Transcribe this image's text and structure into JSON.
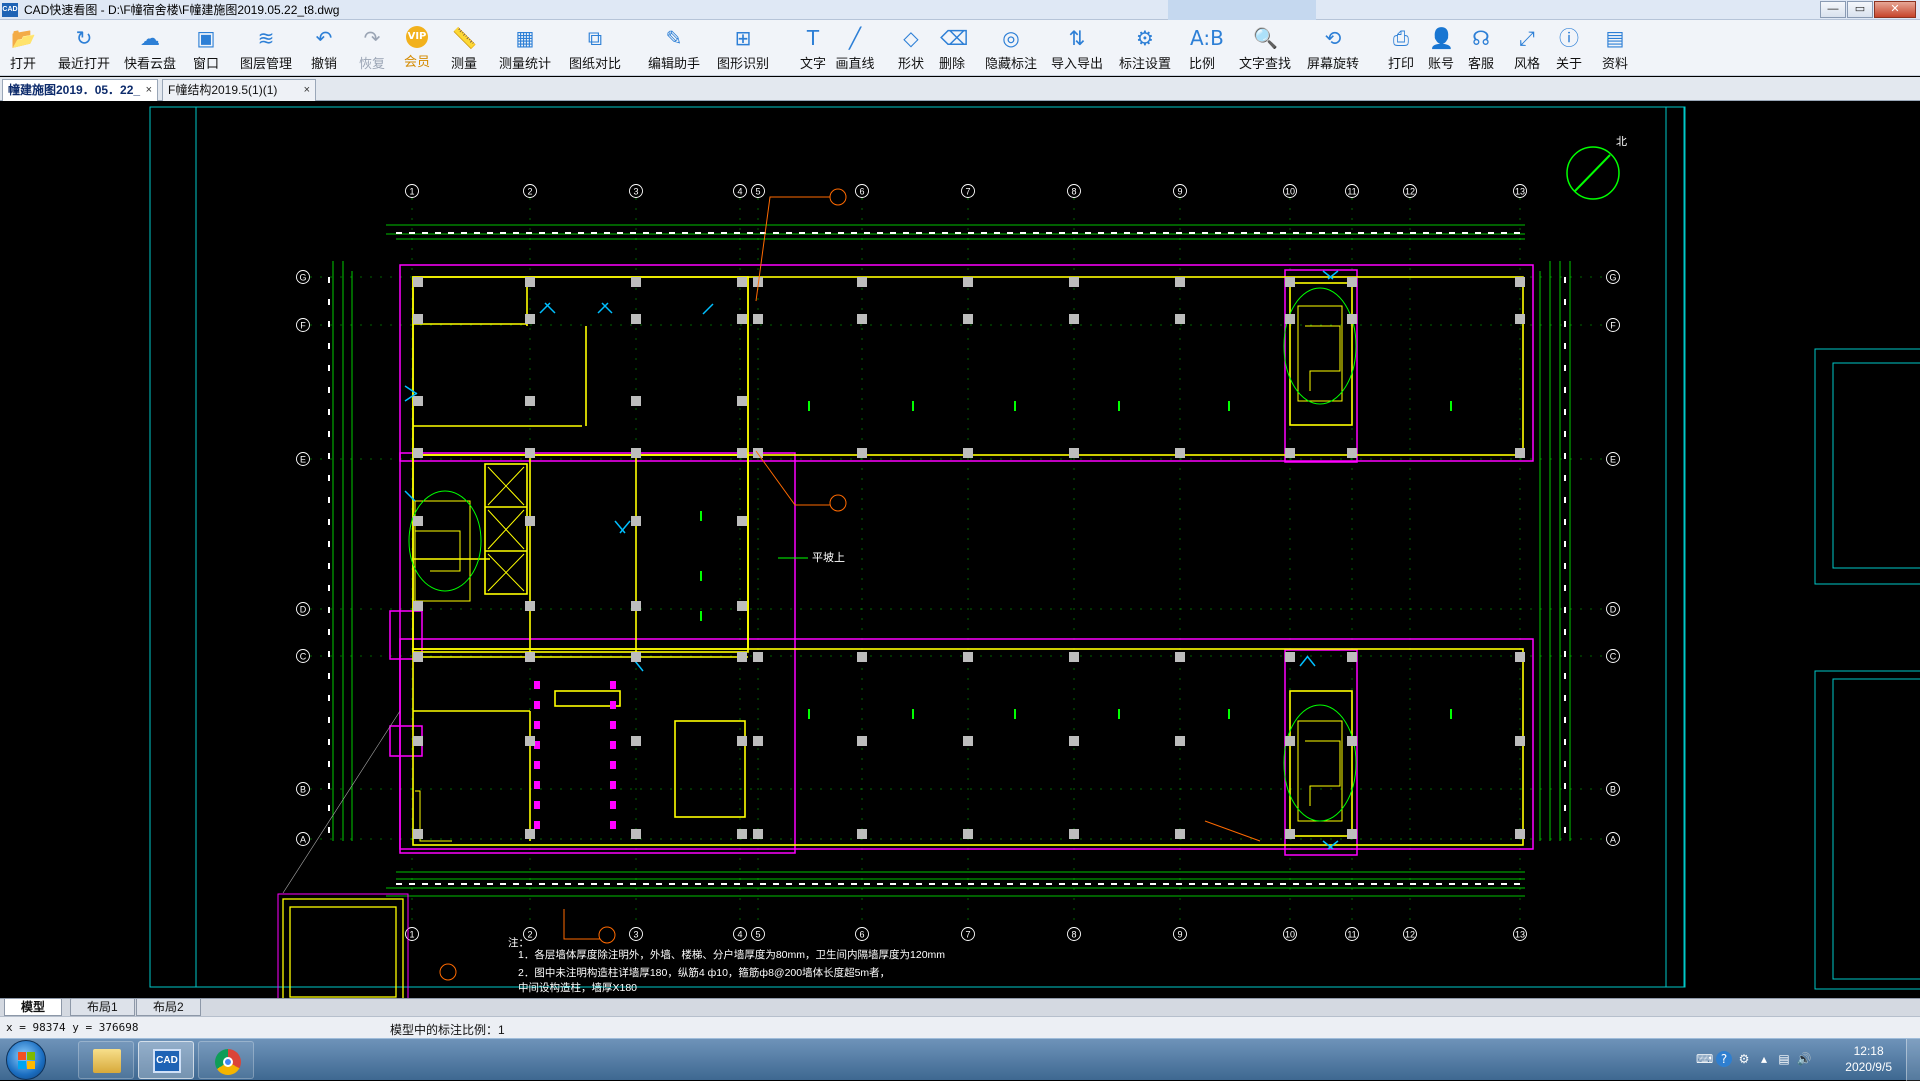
{
  "window": {
    "app_icon_text": "CAD",
    "title": "CAD快速看图 - D:\\F幢宿舍楼\\F幢建施图2019.05.22_t8.dwg",
    "controls": {
      "minimize": "—",
      "restore": "▭",
      "close": "✕"
    }
  },
  "toolbar": {
    "buttons": [
      {
        "label": "打开",
        "icon": "📂"
      },
      {
        "label": "最近打开",
        "icon": "↻"
      },
      {
        "label": "快看云盘",
        "icon": "☁"
      },
      {
        "label": "窗口",
        "icon": "▣"
      },
      {
        "label": "图层管理",
        "icon": "≋"
      },
      {
        "label": "撤销",
        "icon": "↶"
      },
      {
        "label": "恢复",
        "icon": "↷"
      },
      {
        "label": "会员",
        "icon": "VIP"
      },
      {
        "label": "测量",
        "icon": "📏"
      },
      {
        "label": "测量统计",
        "icon": "▦"
      },
      {
        "label": "图纸对比",
        "icon": "⧉"
      },
      {
        "label": "编辑助手",
        "icon": "✎"
      },
      {
        "label": "图形识别",
        "icon": "⊞"
      },
      {
        "label": "文字",
        "icon": "T"
      },
      {
        "label": "画直线",
        "icon": "╱"
      },
      {
        "label": "形状",
        "icon": "◇"
      },
      {
        "label": "删除",
        "icon": "⌫"
      },
      {
        "label": "隐藏标注",
        "icon": "◎"
      },
      {
        "label": "导入导出",
        "icon": "⇅"
      },
      {
        "label": "标注设置",
        "icon": "⚙"
      },
      {
        "label": "比例",
        "icon": "A:B"
      },
      {
        "label": "文字查找",
        "icon": "🔍"
      },
      {
        "label": "屏幕旋转",
        "icon": "⟲"
      },
      {
        "label": "打印",
        "icon": "⎙"
      },
      {
        "label": "账号",
        "icon": "👤"
      },
      {
        "label": "客服",
        "icon": "☊"
      },
      {
        "label": "风格",
        "icon": "⤢"
      },
      {
        "label": "关于",
        "icon": "ⓘ"
      },
      {
        "label": "资料",
        "icon": "▤"
      }
    ]
  },
  "tabs": [
    {
      "label": "幢建施图2019．05．22_",
      "close": "×"
    },
    {
      "label": "F幢结构2019.5(1)(1)",
      "close": "×"
    }
  ],
  "drawing": {
    "axis_top": [
      "1",
      "2",
      "3",
      "4",
      "5",
      "6",
      "7",
      "8",
      "9",
      "10",
      "11",
      "12",
      "13"
    ],
    "axis_side": [
      "G",
      "F",
      "E",
      "D",
      "C",
      "B",
      "A"
    ],
    "north_label": "北",
    "center_label": "平坡上",
    "notes_head": "注：",
    "note_1": "1．各层墙体厚度除注明外，外墙、楼梯、分户墙厚度为80mm，卫生间内隔墙厚度为120mm",
    "note_2": "2．图中未注明构造柱详墙厚180，纵筋4 ф10，箍筋ф8@200墙体长度超5m者，",
    "note_3": "   中间设构造柱，墙厚X180"
  },
  "layout_tabs": [
    "模型",
    "布局1",
    "布局2"
  ],
  "status": {
    "coords": "x = 98374  y = 376698",
    "scale": "模型中的标注比例：1"
  },
  "taskbar": {
    "apps": [
      "文件管理器",
      "CAD快速看图",
      "Chrome"
    ],
    "clock_time": "12:18",
    "clock_date": "2020/9/5"
  },
  "colors": {
    "wall": "#ffff00",
    "outline": "#ff00ff",
    "dimension": "#00ff00",
    "axis": "#ffffff",
    "grid_line": "#00c8c8",
    "accent": "#ff6a00"
  }
}
